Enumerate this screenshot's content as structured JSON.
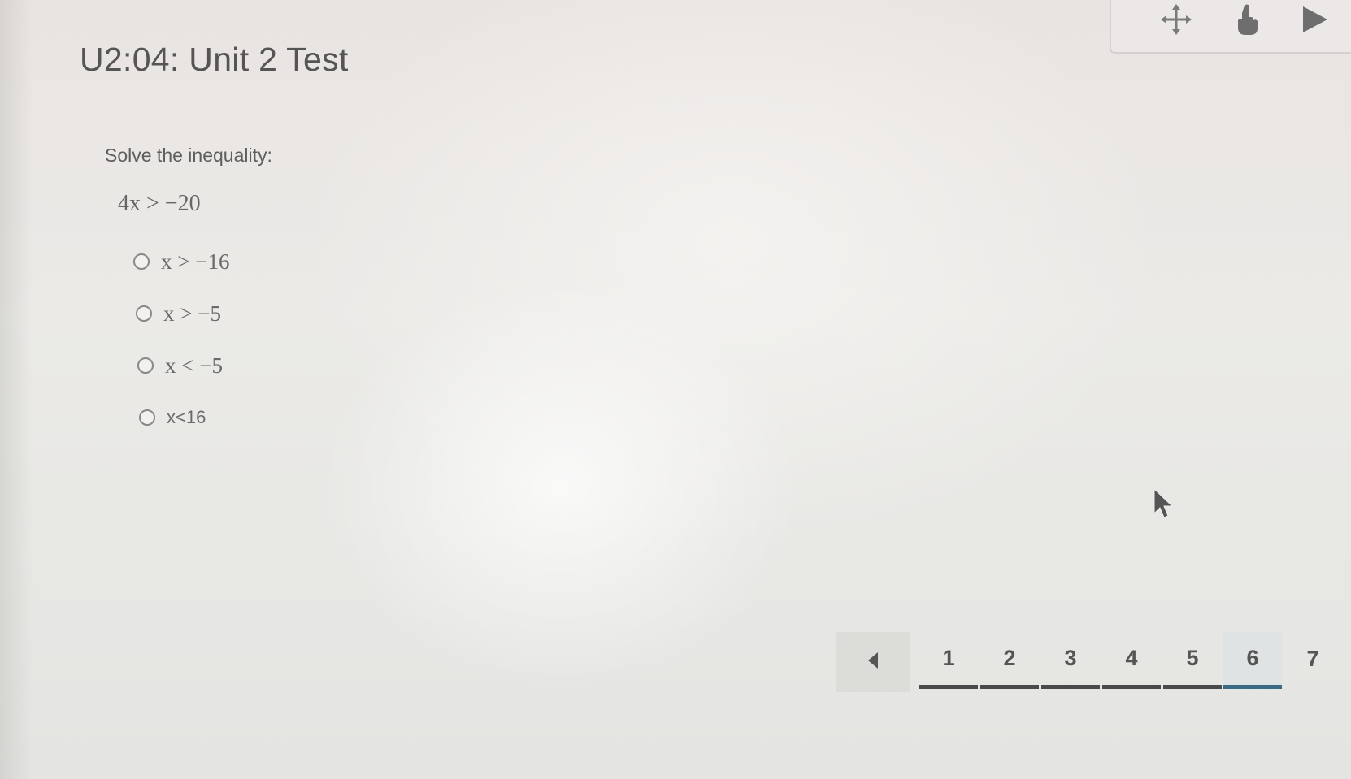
{
  "header": {
    "title": "U2:04: Unit 2 Test"
  },
  "toolbar": {
    "icons": [
      "move-icon",
      "hand-pointer-icon",
      "play-icon"
    ]
  },
  "question": {
    "prompt": "Solve the inequality:",
    "expression": "4x > −20",
    "options": [
      {
        "label": "x > −16"
      },
      {
        "label": "x > −5"
      },
      {
        "label": "x < −5"
      },
      {
        "label": "x<16"
      }
    ]
  },
  "pagination": {
    "prev_icon": "chevron-left-icon",
    "pages": [
      "1",
      "2",
      "3",
      "4",
      "5",
      "6",
      "7"
    ],
    "current_page": "6"
  },
  "colors": {
    "active_page_underline": "#3a6a85"
  }
}
